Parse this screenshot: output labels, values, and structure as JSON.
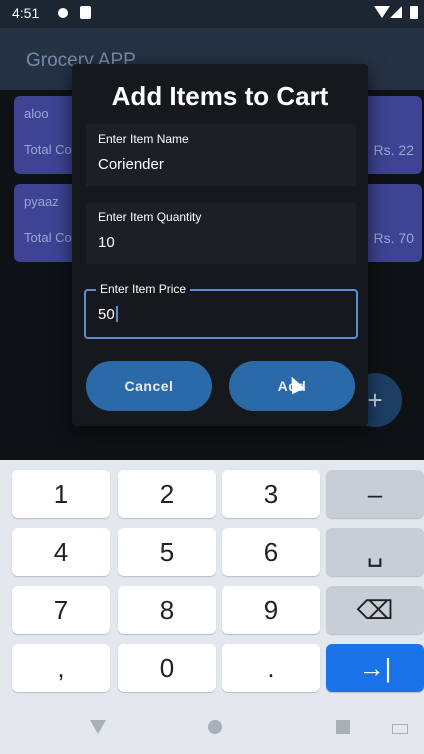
{
  "status": {
    "time": "4:51"
  },
  "appbar": {
    "title": "Grocery APP"
  },
  "items": [
    {
      "name": "aloo",
      "total_label": "Total Co",
      "price": "Rs. 22"
    },
    {
      "name": "pyaaz",
      "total_label": "Total Co",
      "price": "Rs. 70"
    }
  ],
  "fab": {
    "label": "+"
  },
  "dialog": {
    "title": "Add Items to Cart",
    "name_label": "Enter Item Name",
    "name_value": "Coriender",
    "qty_label": "Enter Item Quantity",
    "qty_value": "10",
    "price_label": "Enter Item Price",
    "price_value": "50",
    "cancel_label": "Cancel",
    "add_label": "Add"
  },
  "keyboard": {
    "keys": [
      "1",
      "2",
      "3",
      "–",
      "4",
      "5",
      "6",
      "␣",
      "7",
      "8",
      "9",
      "⌫",
      ",",
      "0",
      ".",
      "→|"
    ]
  }
}
